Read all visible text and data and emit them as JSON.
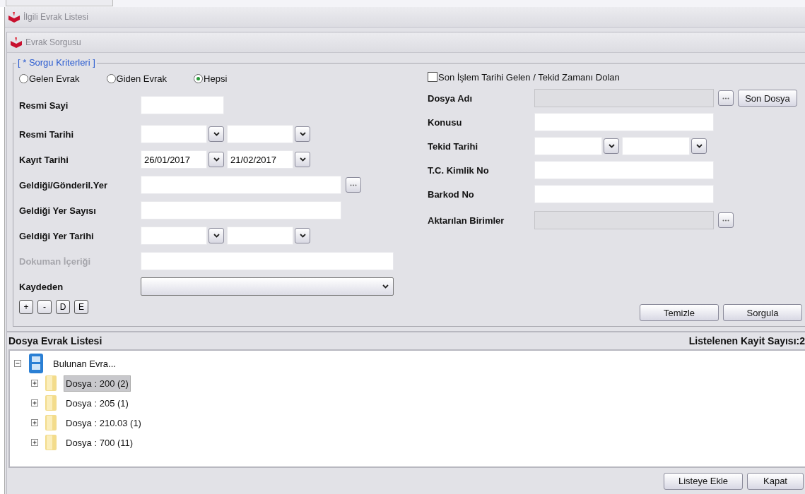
{
  "outer_window": {
    "title": "İlgili Evrak Listesi"
  },
  "inner_window": {
    "title": "Evrak Sorgusu"
  },
  "criteria": {
    "legend": "[ * Sorgu Kriterleri ]",
    "radios": [
      {
        "label": "Gelen Evrak",
        "selected": false
      },
      {
        "label": "Giden Evrak",
        "selected": false
      },
      {
        "label": "Hepsi",
        "selected": true
      }
    ],
    "left_fields": [
      {
        "kind": "short",
        "label": "Resmi Sayi",
        "disabled": false
      },
      {
        "kind": "date",
        "label": "Resmi Tarihi",
        "disabled": false
      },
      {
        "kind": "date",
        "label": "Kayıt Tarihi",
        "disabled": false,
        "from": "26/01/2017",
        "to": "21/02/2017"
      },
      {
        "kind": "browse",
        "label": "Geldiği/Gönderil.Yer",
        "disabled": false
      },
      {
        "kind": "wide",
        "label": "Geldiği Yer Sayısı",
        "disabled": false
      },
      {
        "kind": "date",
        "label": "Geldiği Yer Tarihi",
        "disabled": false
      },
      {
        "kind": "long",
        "label": "Dokuman İçeriği",
        "disabled": true
      },
      {
        "kind": "combo",
        "label": "Kaydeden",
        "disabled": false
      }
    ],
    "tool_buttons": [
      "+",
      "-",
      "D",
      "E"
    ],
    "checkbox": {
      "label": "Son İşlem Tarihi Gelen / Tekid Zamanı Dolan",
      "checked": false
    },
    "right_fields": [
      {
        "kind": "readonly",
        "label": "Dosya Adı",
        "extra_button": "Son Dosya"
      },
      {
        "kind": "text",
        "label": "Konusu"
      },
      {
        "kind": "date",
        "label": "Tekid Tarihi"
      },
      {
        "kind": "text",
        "label": "T.C. Kimlik No"
      },
      {
        "kind": "text",
        "label": "Barkod No"
      },
      {
        "kind": "readonly",
        "label": "Aktarılan Birimler"
      }
    ],
    "actions": [
      "Temizle",
      "Sorgula"
    ]
  },
  "list": {
    "title": "Dosya Evrak Listesi",
    "count": "Listelenen Kayit Sayısı:2",
    "tree": {
      "label": "Bulunan Evra...",
      "expanded": true,
      "children": [
        {
          "label": "Dosya : 200 (2)",
          "selected": true,
          "expanded": false
        },
        {
          "label": "Dosya : 205 (1)",
          "selected": false,
          "expanded": false
        },
        {
          "label": "Dosya : 210.03 (1)",
          "selected": false,
          "expanded": false
        },
        {
          "label": "Dosya : 700 (11)",
          "selected": false,
          "expanded": false
        }
      ]
    }
  },
  "footer_buttons": [
    "Listeye Ekle",
    "Kapat"
  ]
}
